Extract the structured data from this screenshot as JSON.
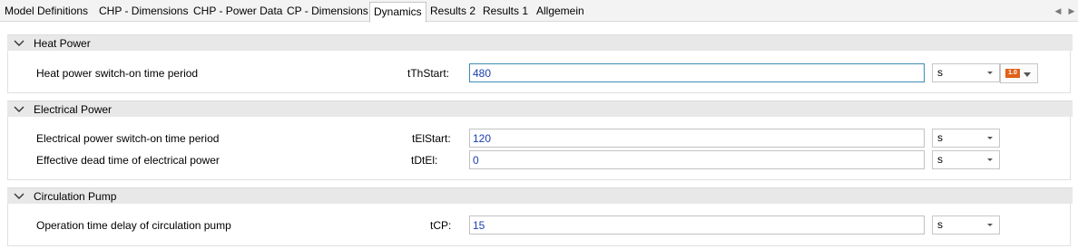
{
  "tabs": [
    {
      "label": "Model Definitions"
    },
    {
      "label": "CHP - Dimensions"
    },
    {
      "label": "CHP - Power Data"
    },
    {
      "label": "CP - Dimensions"
    },
    {
      "label": "Dynamics",
      "active": true
    },
    {
      "label": "Results 2"
    },
    {
      "label": "Results 1"
    },
    {
      "label": "Allgemein"
    }
  ],
  "groups": {
    "heat_power": {
      "title": "Heat Power",
      "rows": [
        {
          "label": "Heat power switch-on time period",
          "var": "tThStart:",
          "value": "480",
          "unit": "s"
        }
      ],
      "badge": "1.0"
    },
    "electrical_power": {
      "title": "Electrical Power",
      "rows": [
        {
          "label": "Electrical power switch-on time period",
          "var": "tElStart:",
          "value": "120",
          "unit": "s"
        },
        {
          "label": "Effective dead time of electrical power",
          "var": "tDtEl:",
          "value": "0",
          "unit": "s"
        }
      ]
    },
    "circulation_pump": {
      "title": "Circulation Pump",
      "rows": [
        {
          "label": "Operation time delay of circulation pump",
          "var": "tCP:",
          "value": "15",
          "unit": "s"
        }
      ]
    }
  },
  "icons": {
    "collapse": "chevron-down-icon",
    "tab_left": "triangle-left-icon",
    "tab_right": "triangle-right-icon"
  },
  "colors": {
    "value_text": "#1b3fb0",
    "badge": "#e0611a",
    "focus_border": "#3f8bb6"
  }
}
